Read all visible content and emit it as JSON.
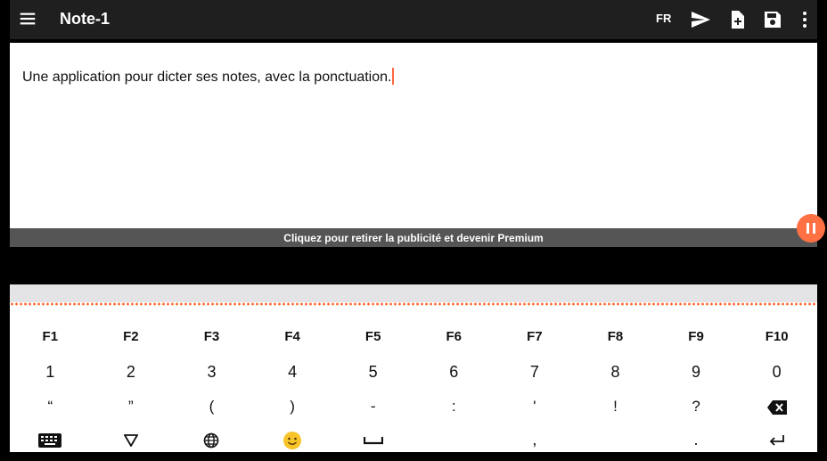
{
  "appbar": {
    "title": "Note-1",
    "language": "FR"
  },
  "editor": {
    "text": "Une application pour dicter ses notes, avec la ponctuation."
  },
  "ad": {
    "text": "Cliquez pour retirer la publicité et devenir Premium"
  },
  "keyboard": {
    "function_keys": [
      "F1",
      "F2",
      "F3",
      "F4",
      "F5",
      "F6",
      "F7",
      "F8",
      "F9",
      "F10"
    ],
    "number_keys": [
      "1",
      "2",
      "3",
      "4",
      "5",
      "6",
      "7",
      "8",
      "9",
      "0"
    ],
    "symbol_keys": [
      "“",
      "”",
      "(",
      ")",
      "-",
      ":",
      "'",
      "!",
      "?"
    ],
    "bottom_keys": {
      "comma": ",",
      "period": "."
    }
  },
  "colors": {
    "accent": "#ff6a3d",
    "appbar": "#1f1f1f",
    "ad_bar": "#555555",
    "fab": "#ff7043"
  },
  "icons": [
    "menu-icon",
    "send-icon",
    "new-note-icon",
    "save-icon",
    "more-vert-icon",
    "pause-icon",
    "backspace-icon",
    "keyboard-icon",
    "hide-keyboard-icon",
    "globe-icon",
    "emoji-icon",
    "space-icon",
    "enter-icon"
  ]
}
